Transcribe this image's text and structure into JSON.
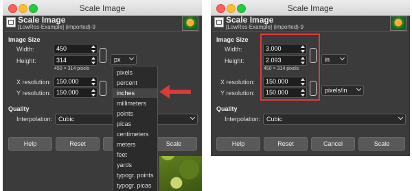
{
  "dialogs": [
    {
      "window_title": "Scale Image",
      "header": {
        "title": "Scale Image",
        "subtitle": "[LowRes-Example] (imported)-9"
      },
      "image_size": {
        "section_title": "Image Size",
        "width_label": "Width:",
        "height_label": "Height:",
        "width_value": "450",
        "height_value": "314",
        "pixels_note": "450 × 314 pixels",
        "unit": "px"
      },
      "resolution": {
        "x_label": "X resolution:",
        "y_label": "Y resolution:",
        "x_value": "150.000",
        "y_value": "150.000"
      },
      "quality": {
        "section_title": "Quality",
        "interpolation_label": "Interpolation:",
        "interpolation_value": "Cubic"
      },
      "buttons": {
        "help": "Help",
        "reset": "Reset",
        "scale": "Scale"
      },
      "unit_menu": {
        "items": [
          "pixels",
          "percent",
          "inches",
          "millimeters",
          "points",
          "picas",
          "centimeters",
          "meters",
          "feet",
          "yards",
          "typogr. points",
          "typogr. picas"
        ],
        "highlighted": "inches"
      }
    },
    {
      "window_title": "Scale Image",
      "header": {
        "title": "Scale Image",
        "subtitle": "[LowRes-Example] (imported)-9"
      },
      "image_size": {
        "section_title": "Image Size",
        "width_label": "Width:",
        "height_label": "Height:",
        "width_value": "3.000",
        "height_value": "2.093",
        "pixels_note": "450 × 314 pixels",
        "unit": "in"
      },
      "resolution": {
        "x_label": "X resolution:",
        "y_label": "Y resolution:",
        "x_value": "150.000",
        "y_value": "150.000",
        "unit": "pixels/in"
      },
      "quality": {
        "section_title": "Quality",
        "interpolation_label": "Interpolation:",
        "interpolation_value": "Cubic"
      },
      "buttons": {
        "help": "Help",
        "reset": "Reset",
        "cancel": "Cancel",
        "scale": "Scale"
      }
    }
  ],
  "colors": {
    "annotation": "#e53a3a",
    "dialog_bg": "#3b3b3b",
    "field_bg": "#1e1e1e"
  }
}
